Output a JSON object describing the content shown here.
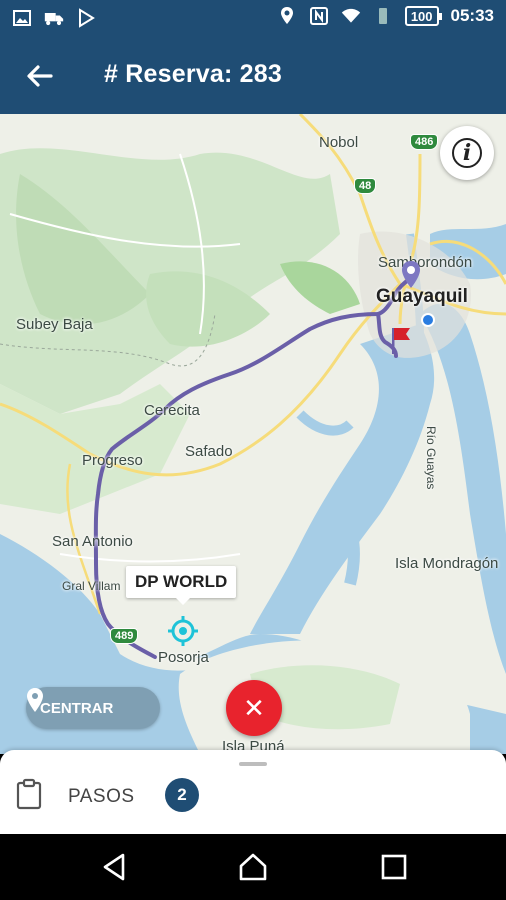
{
  "status_bar": {
    "battery": "100",
    "time": "05:33",
    "icons_left": [
      "image-icon",
      "truck-icon",
      "play-store-icon"
    ],
    "icons_right": [
      "location-icon",
      "nfc-icon",
      "wifi-icon",
      "vibrate-icon",
      "battery-icon"
    ]
  },
  "app_bar": {
    "title": "# Reserva: 283",
    "back_icon": "arrow-left-icon",
    "color": "#1f4d74"
  },
  "map": {
    "places": {
      "nobol": "Nobol",
      "samborondon": "Samborondón",
      "guayaquil": "Guayaquil",
      "subey_baja": "Subey Baja",
      "cerecita": "Cerecita",
      "progreso": "Progreso",
      "safado": "Safado",
      "san_antonio": "San Antonio",
      "gral_villamil": "Gral Villam",
      "posorja": "Posorja",
      "isla_mondragon": "Isla Mondragón",
      "isla_puna": "Isla Puná",
      "rio_guayas": "Río Guayas"
    },
    "routes": {
      "r486": "486",
      "r48": "48",
      "r489": "489"
    },
    "destination_label": "DP WORLD",
    "info_glyph": "i",
    "route_color": "#6a5fa8"
  },
  "centrar_button": {
    "label": "CENTRAR",
    "icon": "map-pin-icon"
  },
  "cancel_button": {
    "glyph": "✕",
    "color": "#e8232d"
  },
  "steps_sheet": {
    "label": "PASOS",
    "count": "2",
    "icon": "clipboard-icon"
  },
  "nav_bar": {
    "icons": [
      "back-triangle-icon",
      "home-circle-icon",
      "recents-square-icon"
    ]
  }
}
